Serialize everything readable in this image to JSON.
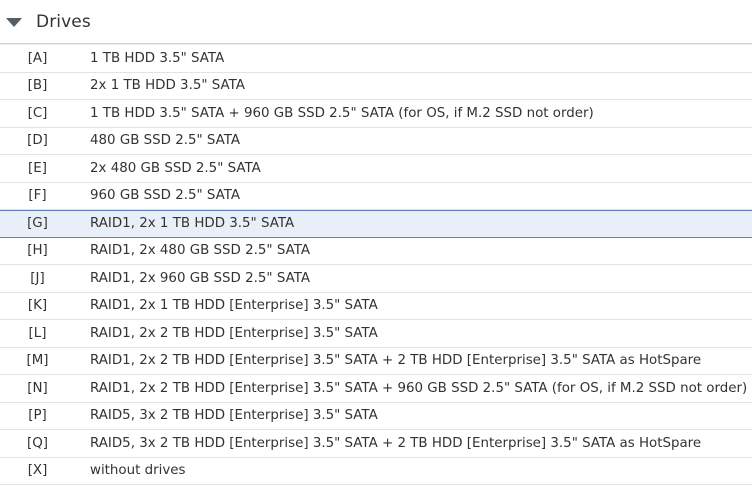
{
  "section": {
    "title": "Drives"
  },
  "options": [
    {
      "key": "[A]",
      "label": "1 TB HDD 3.5\" SATA"
    },
    {
      "key": "[B]",
      "label": "2x 1 TB HDD 3.5\" SATA"
    },
    {
      "key": "[C]",
      "label": "1 TB HDD 3.5\" SATA + 960 GB SSD 2.5\" SATA (for OS, if M.2 SSD not order)"
    },
    {
      "key": "[D]",
      "label": "480 GB SSD 2.5\" SATA"
    },
    {
      "key": "[E]",
      "label": "2x 480 GB SSD 2.5\" SATA"
    },
    {
      "key": "[F]",
      "label": "960 GB SSD 2.5\" SATA"
    },
    {
      "key": "[G]",
      "label": "RAID1, 2x 1 TB HDD 3.5\" SATA",
      "selected": true
    },
    {
      "key": "[H]",
      "label": "RAID1, 2x 480 GB SSD 2.5\" SATA"
    },
    {
      "key": "[J]",
      "label": "RAID1, 2x 960 GB SSD 2.5\" SATA"
    },
    {
      "key": "[K]",
      "label": "RAID1, 2x 1 TB HDD [Enterprise] 3.5\" SATA"
    },
    {
      "key": "[L]",
      "label": "RAID1, 2x 2 TB HDD [Enterprise] 3.5\" SATA"
    },
    {
      "key": "[M]",
      "label": "RAID1, 2x 2 TB HDD [Enterprise] 3.5\" SATA + 2 TB HDD [Enterprise] 3.5\" SATA as HotSpare"
    },
    {
      "key": "[N]",
      "label": "RAID1, 2x 2 TB HDD [Enterprise] 3.5\" SATA + 960 GB SSD 2.5\" SATA (for OS, if M.2 SSD not order)"
    },
    {
      "key": "[P]",
      "label": "RAID5, 3x 2 TB HDD [Enterprise] 3.5\" SATA"
    },
    {
      "key": "[Q]",
      "label": "RAID5, 3x 2 TB HDD [Enterprise] 3.5\" SATA  + 2 TB HDD [Enterprise] 3.5\" SATA as HotSpare"
    },
    {
      "key": "[X]",
      "label": "without drives"
    }
  ],
  "icons": {
    "collapse": "caret-down-icon"
  },
  "colors": {
    "selected_background": "#e9eff9",
    "selected_border": "#5b7fb8"
  }
}
